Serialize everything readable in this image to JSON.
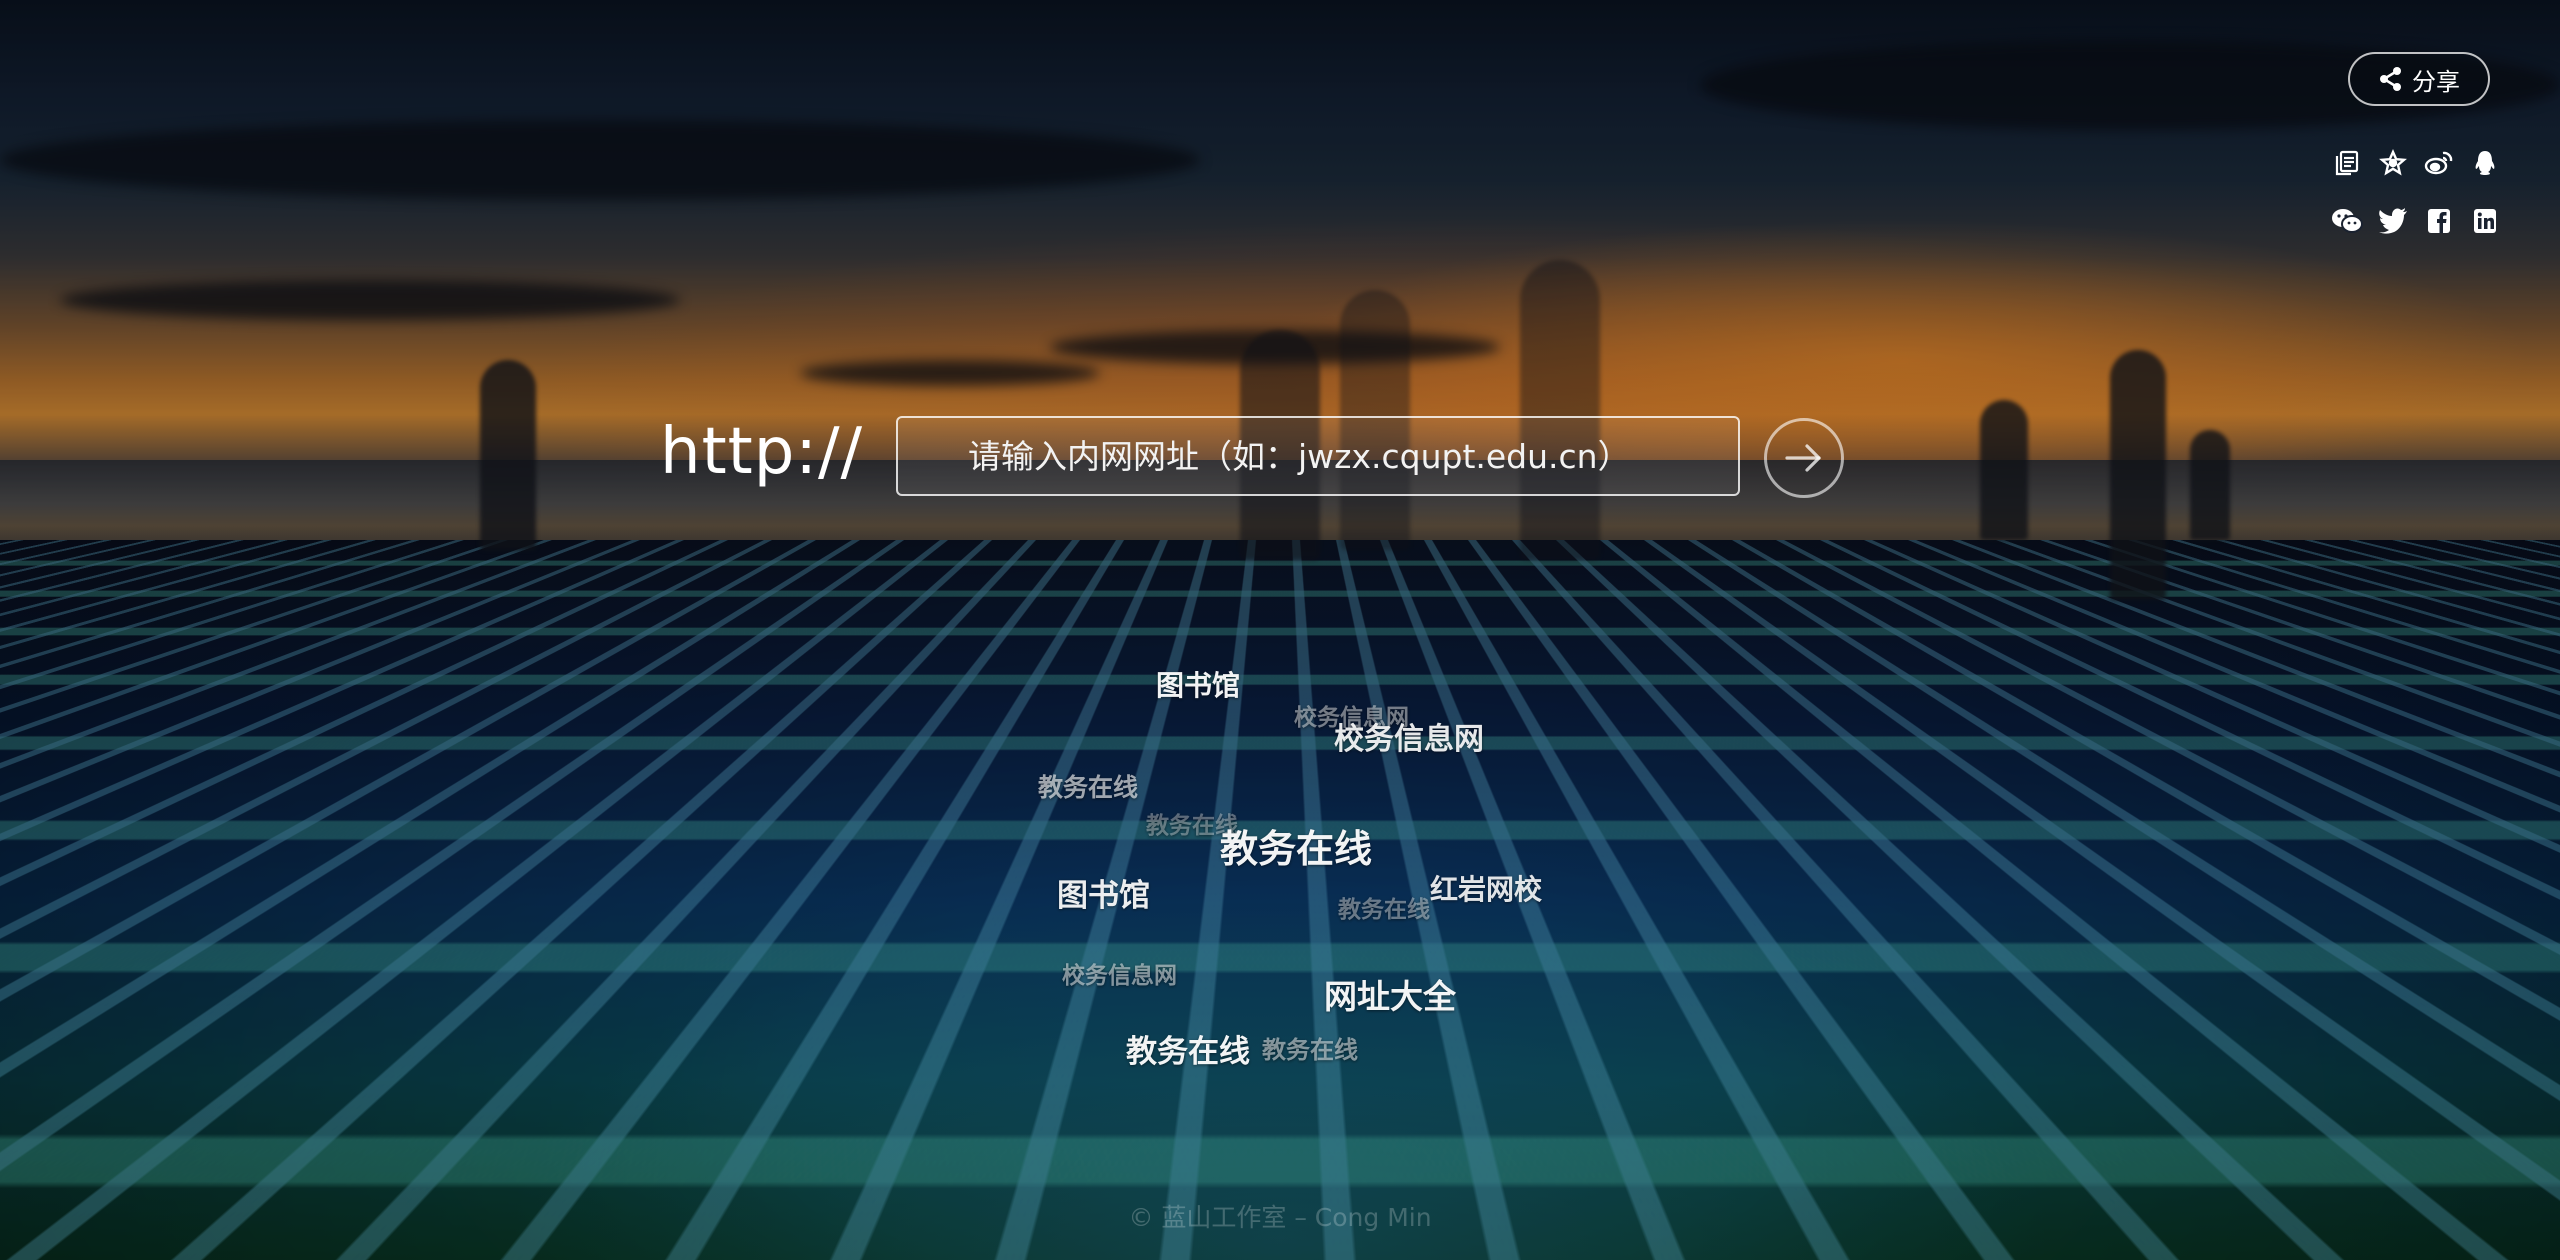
{
  "share": {
    "label": "分享"
  },
  "social_icons": [
    "copy-icon",
    "star-icon",
    "weibo-icon",
    "qq-icon",
    "wechat-icon",
    "twitter-icon",
    "facebook-icon",
    "linkedin-icon"
  ],
  "url_bar": {
    "prefix": "http://",
    "placeholder": "请输入内网网址（如：jwzx.cqupt.edu.cn）",
    "go_icon": "arrow-right-circle-icon"
  },
  "tags": [
    {
      "label": "图书馆"
    },
    {
      "label": "校务信息网"
    },
    {
      "label": "校务信息网"
    },
    {
      "label": "教务在线"
    },
    {
      "label": "教务在线"
    },
    {
      "label": "教务在线"
    },
    {
      "label": "图书馆"
    },
    {
      "label": "红岩网校"
    },
    {
      "label": "教务在线"
    },
    {
      "label": "校务信息网"
    },
    {
      "label": "网址大全"
    },
    {
      "label": "教务在线"
    },
    {
      "label": "教务在线"
    }
  ],
  "footer": {
    "text": "© 蓝山工作室 – Cong Min"
  },
  "colors": {
    "text": "#ffffff",
    "input_border": "#ffffff",
    "background": "#0b2550"
  }
}
